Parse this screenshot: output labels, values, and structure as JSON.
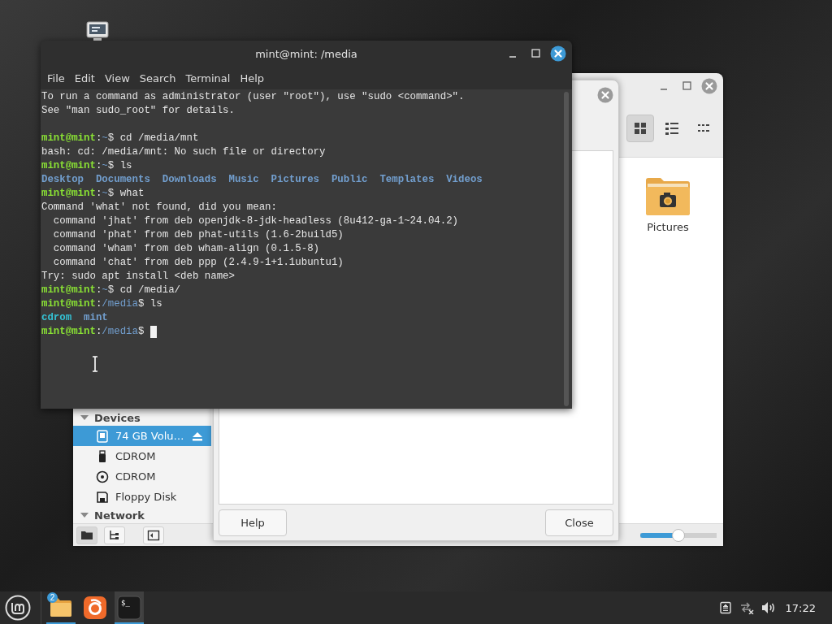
{
  "file_manager": {
    "view_buttons": [
      {
        "kind": "icons",
        "selected": true
      },
      {
        "kind": "list",
        "selected": false
      },
      {
        "kind": "compact",
        "selected": false
      }
    ],
    "sidebar": {
      "sections": [
        {
          "title": "Devices",
          "expanded": true,
          "items": [
            {
              "label": "74 GB Volu…",
              "kind": "drive",
              "selected": true,
              "ejectable": true
            },
            {
              "label": "CDROM",
              "kind": "usb",
              "selected": false,
              "ejectable": false
            },
            {
              "label": "CDROM",
              "kind": "disc",
              "selected": false,
              "ejectable": false
            },
            {
              "label": "Floppy Disk",
              "kind": "floppy",
              "selected": false,
              "ejectable": false
            }
          ]
        },
        {
          "title": "Network",
          "expanded": true
        }
      ]
    },
    "sidebar_buttons": [
      {
        "kind": "places",
        "selected": true
      },
      {
        "kind": "tree",
        "selected": false
      },
      {
        "kind": "toggle",
        "selected": false
      }
    ],
    "files": [
      {
        "name": "Pictures",
        "kind": "pictures-folder"
      }
    ],
    "zoom": {
      "level": 0.5
    }
  },
  "dialog": {
    "buttons": [
      {
        "label": "Help"
      },
      {
        "label": "Close"
      }
    ]
  },
  "terminal": {
    "title": "mint@mint: /media",
    "menu": [
      "File",
      "Edit",
      "View",
      "Search",
      "Terminal",
      "Help"
    ],
    "lines": [
      {
        "segments": [
          {
            "kind": "plain",
            "text": "To run a command as administrator (user \"root\"), use \"sudo <command>\"."
          }
        ]
      },
      {
        "segments": [
          {
            "kind": "plain",
            "text": "See \"man sudo_root\" for details."
          }
        ]
      },
      {
        "gap_before": true,
        "segments": [
          {
            "kind": "user",
            "text": "mint@mint"
          },
          {
            "kind": "plain",
            "text": ":"
          },
          {
            "kind": "path",
            "text": "~"
          },
          {
            "kind": "plain",
            "text": "$ cd /media/mnt"
          }
        ]
      },
      {
        "segments": [
          {
            "kind": "plain",
            "text": "bash: cd: /media/mnt: No such file or directory"
          }
        ]
      },
      {
        "segments": [
          {
            "kind": "user",
            "text": "mint@mint"
          },
          {
            "kind": "plain",
            "text": ":"
          },
          {
            "kind": "path",
            "text": "~"
          },
          {
            "kind": "plain",
            "text": "$ ls"
          }
        ]
      },
      {
        "segments": [
          {
            "kind": "dir",
            "text": "Desktop  Documents  Downloads  Music  Pictures  Public  Templates  Videos"
          }
        ]
      },
      {
        "segments": [
          {
            "kind": "user",
            "text": "mint@mint"
          },
          {
            "kind": "plain",
            "text": ":"
          },
          {
            "kind": "path",
            "text": "~"
          },
          {
            "kind": "plain",
            "text": "$ what"
          }
        ]
      },
      {
        "segments": [
          {
            "kind": "plain",
            "text": "Command 'what' not found, did you mean:"
          }
        ]
      },
      {
        "segments": [
          {
            "kind": "plain",
            "text": "  command 'jhat' from deb openjdk-8-jdk-headless (8u412-ga-1~24.04.2)"
          }
        ]
      },
      {
        "segments": [
          {
            "kind": "plain",
            "text": "  command 'phat' from deb phat-utils (1.6-2build5)"
          }
        ]
      },
      {
        "segments": [
          {
            "kind": "plain",
            "text": "  command 'wham' from deb wham-align (0.1.5-8)"
          }
        ]
      },
      {
        "segments": [
          {
            "kind": "plain",
            "text": "  command 'chat' from deb ppp (2.4.9-1+1.1ubuntu1)"
          }
        ]
      },
      {
        "segments": [
          {
            "kind": "plain",
            "text": "Try: sudo apt install <deb name>"
          }
        ]
      },
      {
        "segments": [
          {
            "kind": "user",
            "text": "mint@mint"
          },
          {
            "kind": "plain",
            "text": ":"
          },
          {
            "kind": "path",
            "text": "~"
          },
          {
            "kind": "plain",
            "text": "$ cd /media/"
          }
        ]
      },
      {
        "segments": [
          {
            "kind": "user",
            "text": "mint@mint"
          },
          {
            "kind": "plain",
            "text": ":"
          },
          {
            "kind": "path",
            "text": "/media"
          },
          {
            "kind": "plain",
            "text": "$ ls"
          }
        ]
      },
      {
        "segments": [
          {
            "kind": "link",
            "text": "cdrom"
          },
          {
            "kind": "dir",
            "text": "  mint"
          }
        ]
      },
      {
        "cursor": true,
        "segments": [
          {
            "kind": "user",
            "text": "mint@mint"
          },
          {
            "kind": "plain",
            "text": ":"
          },
          {
            "kind": "path",
            "text": "/media"
          },
          {
            "kind": "plain",
            "text": "$ "
          }
        ]
      }
    ]
  },
  "taskbar": {
    "apps": [
      {
        "kind": "files",
        "badge": "2",
        "running": true,
        "focused": false
      },
      {
        "kind": "browser",
        "running": false,
        "focused": false
      },
      {
        "kind": "terminal",
        "icon_text": "$_",
        "running": true,
        "focused": true
      }
    ],
    "clock": "17:22"
  }
}
